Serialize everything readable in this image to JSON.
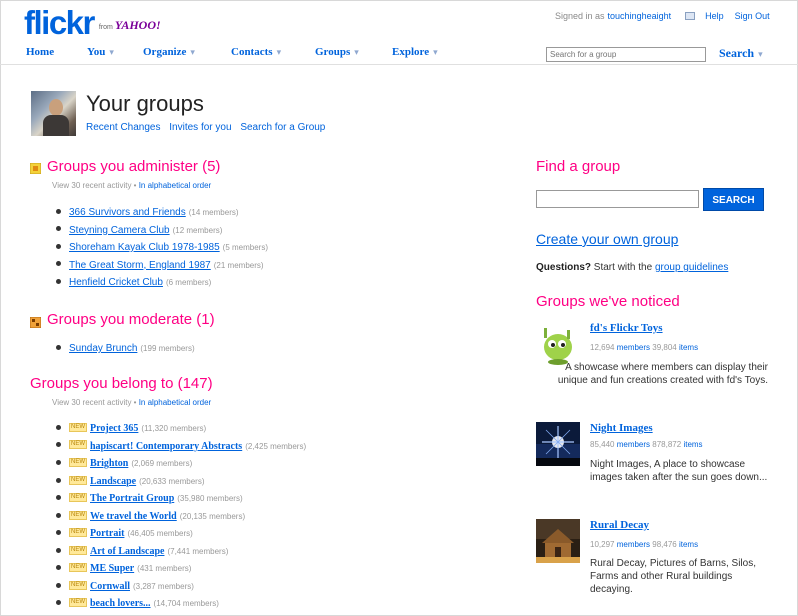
{
  "header": {
    "logo_text": "flickr",
    "logo_from": "from",
    "logo_yahoo": "YAHOO!",
    "signed_in_label": "Signed in as",
    "username": "touchingheaight",
    "help": "Help",
    "sign_out": "Sign Out"
  },
  "nav": {
    "items": [
      {
        "label": "Home",
        "arrow": ""
      },
      {
        "label": "You",
        "arrow": "▾"
      },
      {
        "label": "Organize",
        "arrow": "▾"
      },
      {
        "label": "Contacts",
        "arrow": "▾"
      },
      {
        "label": "Groups",
        "arrow": "▾"
      },
      {
        "label": "Explore",
        "arrow": "▾"
      }
    ],
    "search_placeholder": "Search for a group",
    "search_label": "Search",
    "search_arrow": "▾"
  },
  "page": {
    "title": "Your groups",
    "subnav": [
      "Recent Changes",
      "Invites for you",
      "Search for a Group"
    ]
  },
  "administer": {
    "heading": "Groups you administer (5)",
    "sub_text": "View 30 recent activity •",
    "sub_link": "In alphabetical order",
    "groups": [
      {
        "name": "366 Survivors and Friends",
        "members": "(14 members)"
      },
      {
        "name": "Steyning Camera Club",
        "members": "(12 members)"
      },
      {
        "name": "Shoreham Kayak Club 1978-1985",
        "members": "(5 members)"
      },
      {
        "name": "The Great Storm, England 1987",
        "members": "(21 members)"
      },
      {
        "name": "Henfield Cricket Club",
        "members": "(6 members)"
      }
    ]
  },
  "moderate": {
    "heading": "Groups you moderate (1)",
    "groups": [
      {
        "name": "Sunday Brunch",
        "members": "(199 members)"
      }
    ]
  },
  "belong": {
    "heading": "Groups you belong to (147)",
    "sub_text": "View 30 recent activity •",
    "sub_link": "In alphabetical order",
    "new_label": "NEW",
    "groups": [
      {
        "name": "Project 365",
        "members": "(11,320 members)"
      },
      {
        "name": "hapiscart! Contemporary Abstracts",
        "members": "(2,425 members)"
      },
      {
        "name": "Brighton",
        "members": "(2,069 members)"
      },
      {
        "name": "Landscape",
        "members": "(20,633 members)"
      },
      {
        "name": "The Portrait Group",
        "members": "(35,980 members)"
      },
      {
        "name": "We travel the World",
        "members": "(20,135 members)"
      },
      {
        "name": "Portrait",
        "members": "(46,405 members)"
      },
      {
        "name": "Art of Landscape",
        "members": "(7,441 members)"
      },
      {
        "name": "ME Super",
        "members": "(431 members)"
      },
      {
        "name": "Cornwall",
        "members": "(3,287 members)"
      },
      {
        "name": "beach lovers...",
        "members": "(14,704 members)"
      }
    ]
  },
  "sidebar": {
    "find_heading": "Find a group",
    "search_button": "SEARCH",
    "create_link": "Create your own group",
    "questions_bold": "Questions?",
    "questions_text": "Start with the",
    "questions_link": "group guidelines",
    "noticed_heading": "Groups we've noticed",
    "noticed": [
      {
        "name": "fd's Flickr Toys",
        "count": "12,694",
        "members_label": "members",
        "items_count": "39,804",
        "items_label": "items",
        "description": "A showcase where members can display their unique and fun creations created with fd's Toys."
      },
      {
        "name": "Night Images",
        "count": "85,440",
        "members_label": "members",
        "items_count": "878,872",
        "items_label": "items",
        "description": "Night Images, A place to showcase images taken after the sun goes down..."
      },
      {
        "name": "Rural Decay",
        "count": "10,297",
        "members_label": "members",
        "items_count": "98,476",
        "items_label": "items",
        "description": "Rural Decay, Pictures of Barns, Silos, Farms and other Rural buildings decaying."
      }
    ]
  },
  "colors": {
    "brand_blue": "#0063dc",
    "brand_pink": "#ff0084",
    "muted": "#999999"
  }
}
